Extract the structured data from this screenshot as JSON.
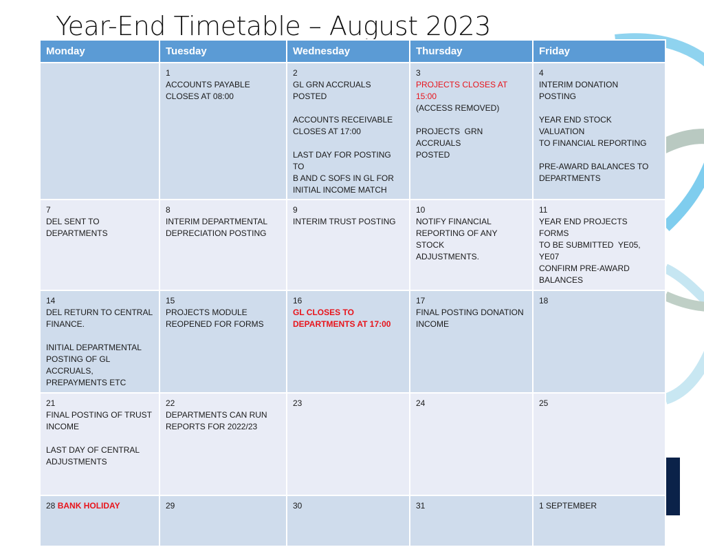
{
  "title": "Year-End Timetable – August 2023",
  "colors": {
    "header_bg": "#5b9bd5",
    "row_dark": "#cfdcec",
    "row_light": "#e9ecf6",
    "highlight_red": "#e8141b",
    "accent_navy": "#0b2249"
  },
  "headers": [
    "Monday",
    "Tuesday",
    "Wednesday",
    "Thursday",
    "Friday"
  ],
  "weeks": [
    {
      "days": [
        {
          "date": "",
          "blocks": []
        },
        {
          "date": "1",
          "blocks": [
            {
              "lines": [
                "ACCOUNTS PAYABLE",
                "CLOSES AT 08:00"
              ]
            }
          ]
        },
        {
          "date": "2",
          "blocks": [
            {
              "lines": [
                "GL GRN ACCRUALS POSTED"
              ]
            },
            {
              "lines": [
                "ACCOUNTS RECEIVABLE",
                "CLOSES AT 17:00"
              ]
            },
            {
              "lines": [
                "LAST DAY FOR POSTING TO",
                "B AND C SOFS IN GL FOR",
                "INITIAL INCOME MATCH"
              ]
            }
          ]
        },
        {
          "date": "3",
          "blocks": [
            {
              "lines": [
                "PROJECTS CLOSES AT 15:00"
              ],
              "style": "red"
            },
            {
              "lines": [
                "(ACCESS REMOVED)"
              ],
              "attach": true
            },
            {
              "lines": [
                "PROJECTS  GRN ACCRUALS",
                "POSTED"
              ]
            }
          ]
        },
        {
          "date": "4",
          "blocks": [
            {
              "lines": [
                "INTERIM DONATION",
                "POSTING"
              ]
            },
            {
              "lines": [
                "YEAR END STOCK VALUATION",
                "TO FINANCIAL REPORTING"
              ]
            },
            {
              "lines": [
                "PRE-AWARD BALANCES TO",
                "DEPARTMENTS"
              ]
            }
          ]
        }
      ]
    },
    {
      "days": [
        {
          "date": "7",
          "blocks": [
            {
              "lines": [
                "DEL SENT TO",
                "DEPARTMENTS"
              ]
            }
          ]
        },
        {
          "date": "8",
          "blocks": [
            {
              "lines": [
                "INTERIM DEPARTMENTAL",
                "DEPRECIATION POSTING"
              ]
            }
          ]
        },
        {
          "date": "9",
          "blocks": [
            {
              "lines": [
                "INTERIM TRUST POSTING"
              ]
            }
          ]
        },
        {
          "date": "10",
          "blocks": [
            {
              "lines": [
                "NOTIFY FINANCIAL",
                "REPORTING OF ANY STOCK",
                "ADJUSTMENTS."
              ]
            }
          ]
        },
        {
          "date": "11",
          "blocks": [
            {
              "lines": [
                "YEAR END PROJECTS FORMS",
                "TO BE SUBMITTED  YE05,",
                "YE07"
              ]
            },
            {
              "lines": [
                "CONFIRM PRE-AWARD",
                "BALANCES"
              ],
              "attach": true
            }
          ]
        }
      ]
    },
    {
      "days": [
        {
          "date": "14",
          "blocks": [
            {
              "lines": [
                "DEL RETURN TO CENTRAL",
                "FINANCE."
              ]
            },
            {
              "lines": [
                "INITIAL DEPARTMENTAL",
                "POSTING OF GL",
                "ACCRUALS,",
                "PREPAYMENTS ETC"
              ]
            }
          ]
        },
        {
          "date": "15",
          "blocks": [
            {
              "lines": [
                "PROJECTS MODULE",
                "REOPENED FOR FORMS"
              ]
            }
          ]
        },
        {
          "date": "16",
          "blocks": [
            {
              "lines": [
                "GL CLOSES TO",
                "DEPARTMENTS AT 17:00"
              ],
              "style": "red-bold"
            }
          ]
        },
        {
          "date": "17",
          "blocks": [
            {
              "lines": [
                "FINAL POSTING DONATION",
                "INCOME"
              ]
            }
          ]
        },
        {
          "date": "18",
          "blocks": []
        }
      ]
    },
    {
      "days": [
        {
          "date": "21",
          "blocks": [
            {
              "lines": [
                "FINAL POSTING OF TRUST",
                "INCOME"
              ]
            },
            {
              "lines": [
                "LAST DAY OF CENTRAL",
                "ADJUSTMENTS"
              ]
            }
          ]
        },
        {
          "date": "22",
          "blocks": [
            {
              "lines": [
                "DEPARTMENTS CAN RUN",
                "REPORTS FOR 2022/23"
              ]
            }
          ]
        },
        {
          "date": "23",
          "blocks": []
        },
        {
          "date": "24",
          "blocks": []
        },
        {
          "date": "25",
          "blocks": []
        }
      ]
    },
    {
      "days": [
        {
          "date": "28",
          "inline_note": "BANK HOLIDAY",
          "inline_style": "red-bold",
          "blocks": []
        },
        {
          "date": "29",
          "blocks": []
        },
        {
          "date": "30",
          "blocks": []
        },
        {
          "date": "31",
          "blocks": []
        },
        {
          "date": "1 SEPTEMBER",
          "blocks": []
        }
      ]
    }
  ]
}
